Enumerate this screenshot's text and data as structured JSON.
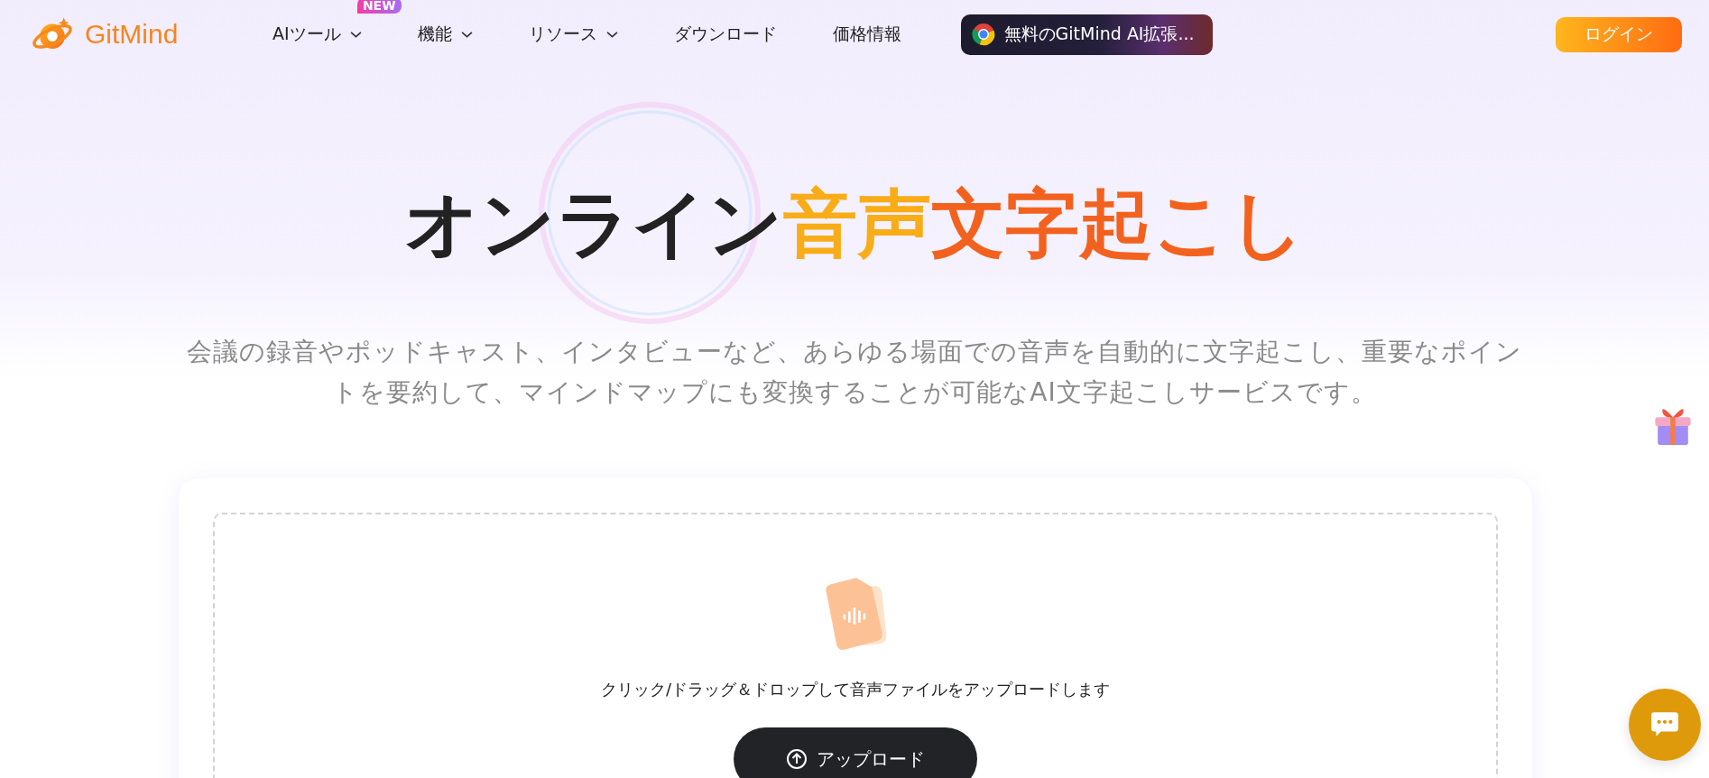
{
  "header": {
    "logo": "GitMind",
    "nav": [
      {
        "label": "AIツール",
        "dropdown": true,
        "badge": "NEW"
      },
      {
        "label": "機能",
        "dropdown": true
      },
      {
        "label": "リソース",
        "dropdown": true
      },
      {
        "label": "ダウンロード",
        "dropdown": false
      },
      {
        "label": "価格情報",
        "dropdown": false
      }
    ],
    "extension_button": "無料のGitMind AI拡張...",
    "login_button": "ログイン"
  },
  "hero": {
    "title_parts": [
      {
        "text": "オンライン",
        "color": "#222222"
      },
      {
        "text": "音声",
        "color": "#f8ad18"
      },
      {
        "text": "文字起こし",
        "color": "#f2621e"
      }
    ],
    "subtitle": "会議の録音やポッドキャスト、インタビューなど、あらゆる場面での音声を自動的に文字起こし、重要なポイントを要約して、マインドマップにも変換することが可能なAI文字起こしサービスです。"
  },
  "upload": {
    "hint": "クリック/ドラッグ＆ドロップして音声ファイルをアップロードします",
    "button": "アップロード"
  }
}
